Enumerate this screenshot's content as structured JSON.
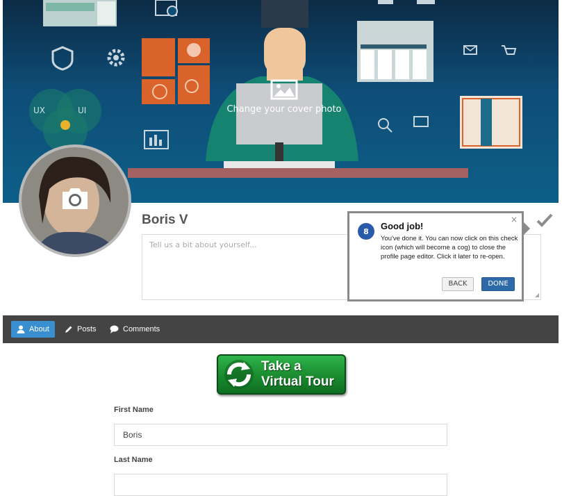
{
  "cover": {
    "change_label": "Change your cover photo",
    "decor_labels": {
      "ux": "UX",
      "ui": "UI"
    },
    "icon": "image-icon"
  },
  "profile": {
    "name": "Boris V",
    "bio_placeholder": "Tell us a bit about yourself..."
  },
  "tour_popup": {
    "step": "8",
    "title": "Good job!",
    "text": "You've done it. You can now click on this check icon (which will become a cog) to close the profile page editor. Click it later to re-open.",
    "close": "×",
    "back_label": "BACK",
    "done_label": "DONE"
  },
  "tabs": [
    {
      "label": "About",
      "icon": "user-icon",
      "active": true
    },
    {
      "label": "Posts",
      "icon": "pencil-icon",
      "active": false
    },
    {
      "label": "Comments",
      "icon": "speech-bubble-icon",
      "active": false
    }
  ],
  "virtual_tour": {
    "line1": "Take a",
    "line2": "Virtual Tour"
  },
  "form": {
    "first_name_label": "First Name",
    "first_name_value": "Boris",
    "last_name_label": "Last Name",
    "last_name_value": ""
  },
  "colors": {
    "accent": "#3a8fd0",
    "tabbar": "#444444",
    "done_button": "#2f6aa8",
    "step_badge": "#2a5ba8",
    "cover_bg": "#0e4d77"
  }
}
